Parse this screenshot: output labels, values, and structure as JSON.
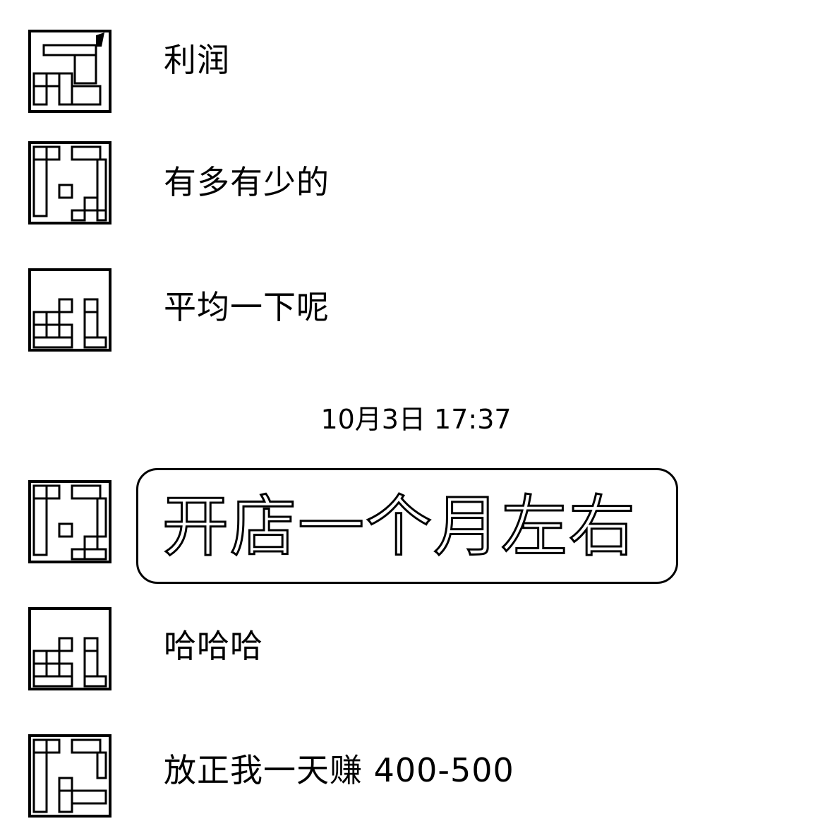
{
  "messages": [
    {
      "text": "利润"
    },
    {
      "text": "有多有少的"
    },
    {
      "text": "平均一下呢"
    },
    {
      "text": "开店一个月左右"
    },
    {
      "text": "哈哈哈"
    },
    {
      "text": "放正我一天赚 400-500"
    }
  ],
  "timestamp": "10月3日 17:37",
  "icons": {
    "avatar": "pixel-avatar-icon"
  }
}
